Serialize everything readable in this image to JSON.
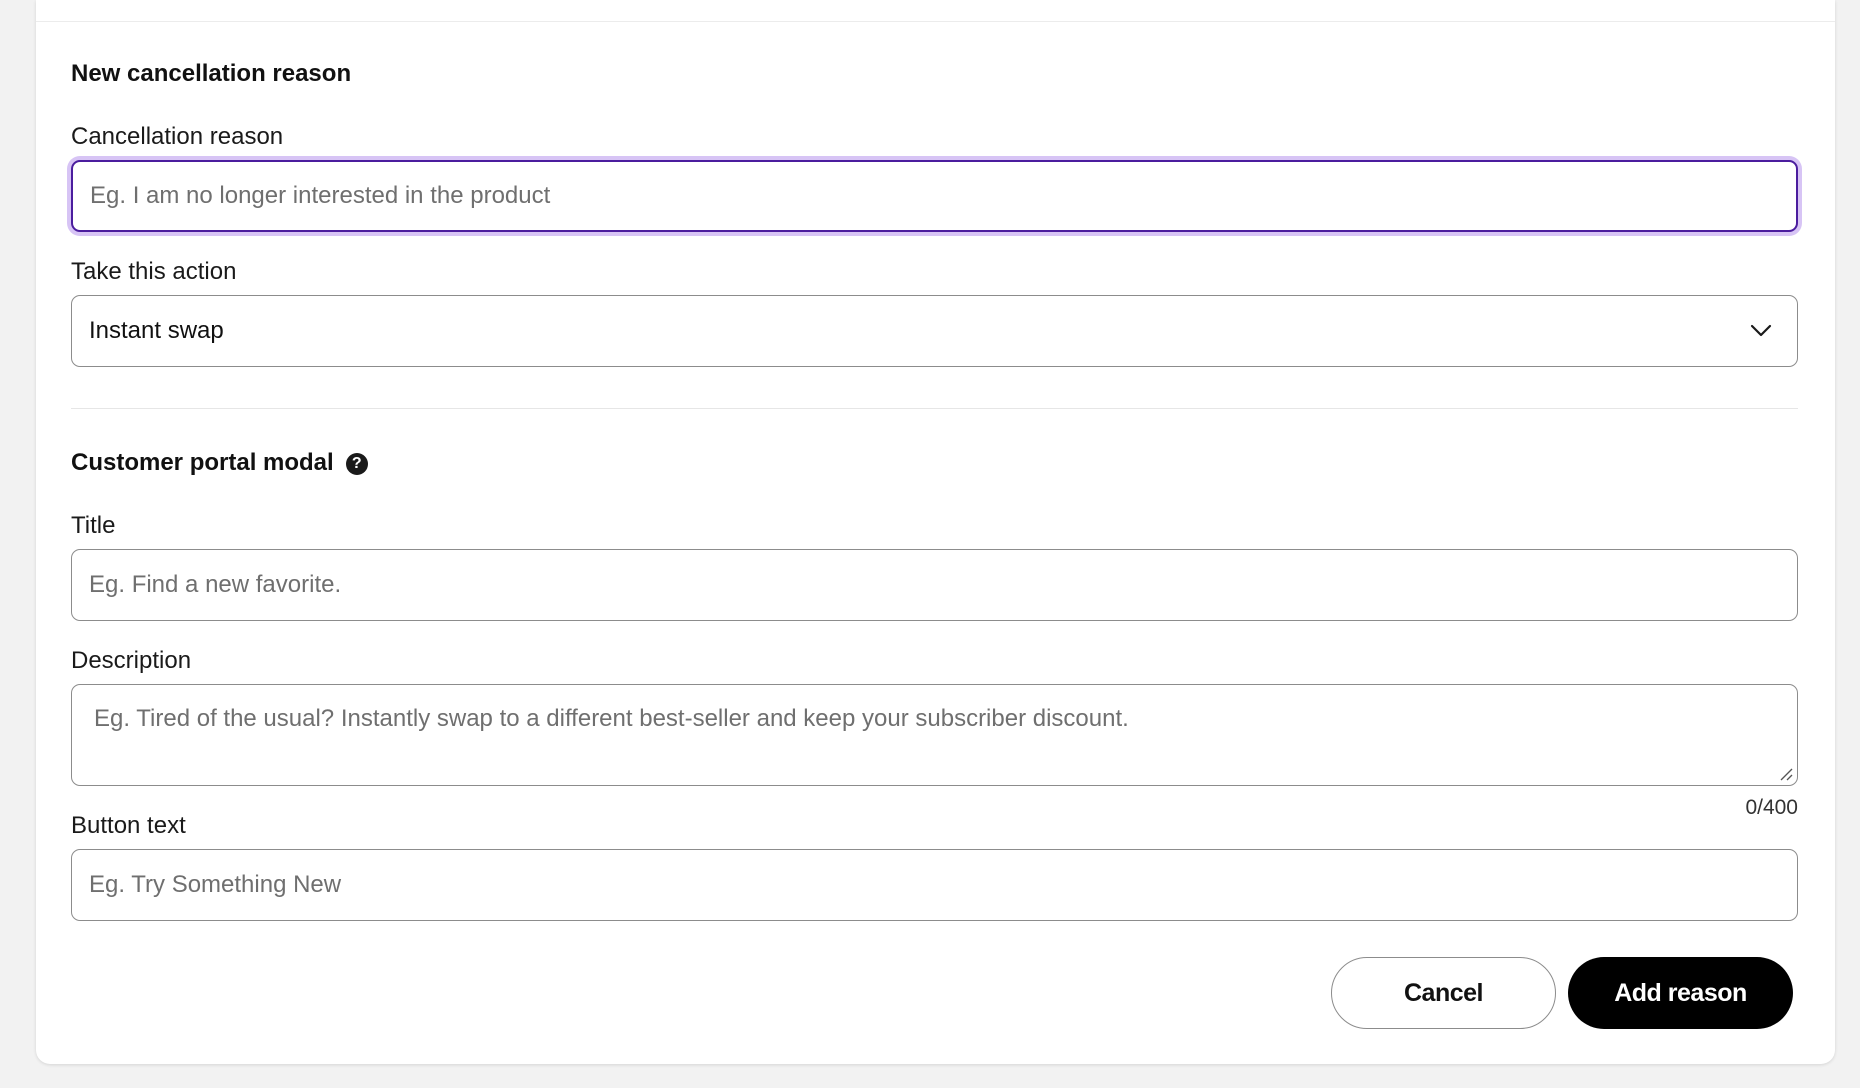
{
  "section_new": {
    "title": "New cancellation reason",
    "reason_label": "Cancellation reason",
    "reason_placeholder": "Eg. I am no longer interested in the product",
    "reason_value": "",
    "action_label": "Take this action",
    "action_selected": "Instant swap"
  },
  "section_modal": {
    "title": "Customer portal modal",
    "help_glyph": "?",
    "title_label": "Title",
    "title_placeholder": "Eg. Find a new favorite.",
    "description_label": "Description",
    "description_placeholder": "Eg. Tired of the usual? Instantly swap to a different best-seller and keep your subscriber discount.",
    "description_counter": "0/400",
    "button_text_label": "Button text",
    "button_text_placeholder": "Eg. Try Something New"
  },
  "footer": {
    "cancel_label": "Cancel",
    "add_label": "Add reason"
  },
  "colors": {
    "focus_border": "#4b1d9e",
    "focus_ring": "#d7c4f5",
    "primary_button": "#000000"
  },
  "icons": {
    "help": "question-circle-icon",
    "dropdown": "chevron-down-icon",
    "resize": "resize-grip-icon"
  }
}
